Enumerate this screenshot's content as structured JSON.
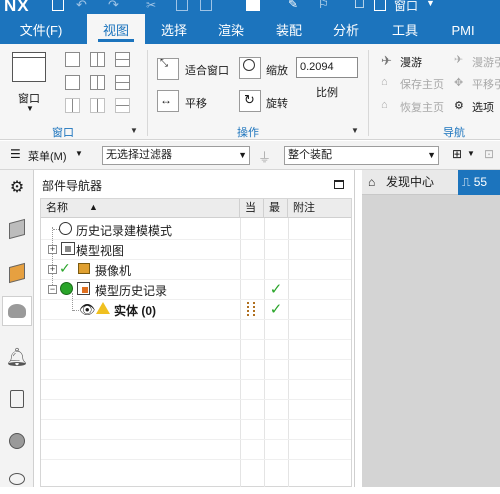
{
  "titlebar": {
    "logo": "NX",
    "window_label": "窗口"
  },
  "menu": {
    "tabs": [
      {
        "label": "文件(F)",
        "active": false
      },
      {
        "label": "视图",
        "active": true
      },
      {
        "label": "选择",
        "active": false
      },
      {
        "label": "渲染",
        "active": false
      },
      {
        "label": "装配",
        "active": false
      },
      {
        "label": "分析",
        "active": false
      },
      {
        "label": "工具",
        "active": false
      },
      {
        "label": "PMI",
        "active": false
      }
    ]
  },
  "ribbon": {
    "window_group": {
      "window_button": "窗口",
      "label": "窗口"
    },
    "operation_group": {
      "fit_window": "适合窗口",
      "zoom": "缩放",
      "pan": "平移",
      "rotate": "旋转",
      "scale_value": "0.2094",
      "scale_label": "比例",
      "label": "操作"
    },
    "navigation_group": {
      "roam": "漫游",
      "save_home": "保存主页",
      "restore_home": "恢复主页",
      "label": "导航",
      "roam2": "漫游引",
      "pan2": "平移引",
      "options": "选项"
    }
  },
  "toolbar2": {
    "menu_button": "菜单(M)",
    "filter_value": "无选择过滤器",
    "assembly_value": "整个装配"
  },
  "navigator": {
    "title": "部件导航器",
    "columns": [
      "名称",
      "当",
      "最",
      "附注"
    ],
    "rows": [
      {
        "label": "历史记录建模模式"
      },
      {
        "label": "模型视图"
      },
      {
        "label": "摄像机"
      },
      {
        "label": "模型历史记录"
      },
      {
        "label": "实体 (0)"
      }
    ]
  },
  "right_panel": {
    "tabs": [
      {
        "label": "发现中心"
      },
      {
        "label": "55"
      }
    ]
  },
  "colors": {
    "accent": "#1c74bd",
    "check_green": "#2aa52a",
    "ribbon_bg": "#f6f6f6"
  }
}
